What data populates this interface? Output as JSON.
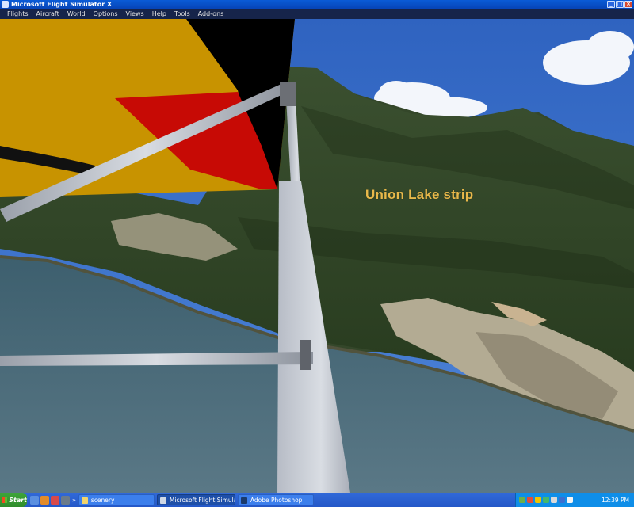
{
  "window": {
    "title": "Microsoft Flight Simulator X"
  },
  "menu": [
    "Flights",
    "Aircraft",
    "World",
    "Options",
    "Views",
    "Help",
    "Tools",
    "Add-ons"
  ],
  "scene": {
    "label": "Union Lake strip",
    "label_color": "#e8b84a",
    "wing_colors": {
      "yellow": "#c89300",
      "red": "#c70a05",
      "black": "#000000"
    },
    "sky_color": "#3a6fc8",
    "water_color": "#4d6b78",
    "forest_color": "#2f4424"
  },
  "taskbar": {
    "start_label": "Start",
    "quicklaunch_icons": [
      "desktop-icon",
      "browser-icon",
      "media-icon",
      "shield-icon"
    ],
    "tasks": [
      {
        "label": "scenery",
        "icon": "folder-icon",
        "active": false
      },
      {
        "label": "Microsoft Flight Simulat...",
        "icon": "fsx-icon",
        "active": true
      },
      {
        "label": "Adobe Photoshop",
        "icon": "photoshop-icon",
        "active": false
      }
    ],
    "tray_icons": [
      "network-icon",
      "antivirus-icon",
      "update-icon",
      "sync-icon",
      "volume-icon",
      "security-icon",
      "power-icon"
    ],
    "clock": "12:39 PM"
  }
}
